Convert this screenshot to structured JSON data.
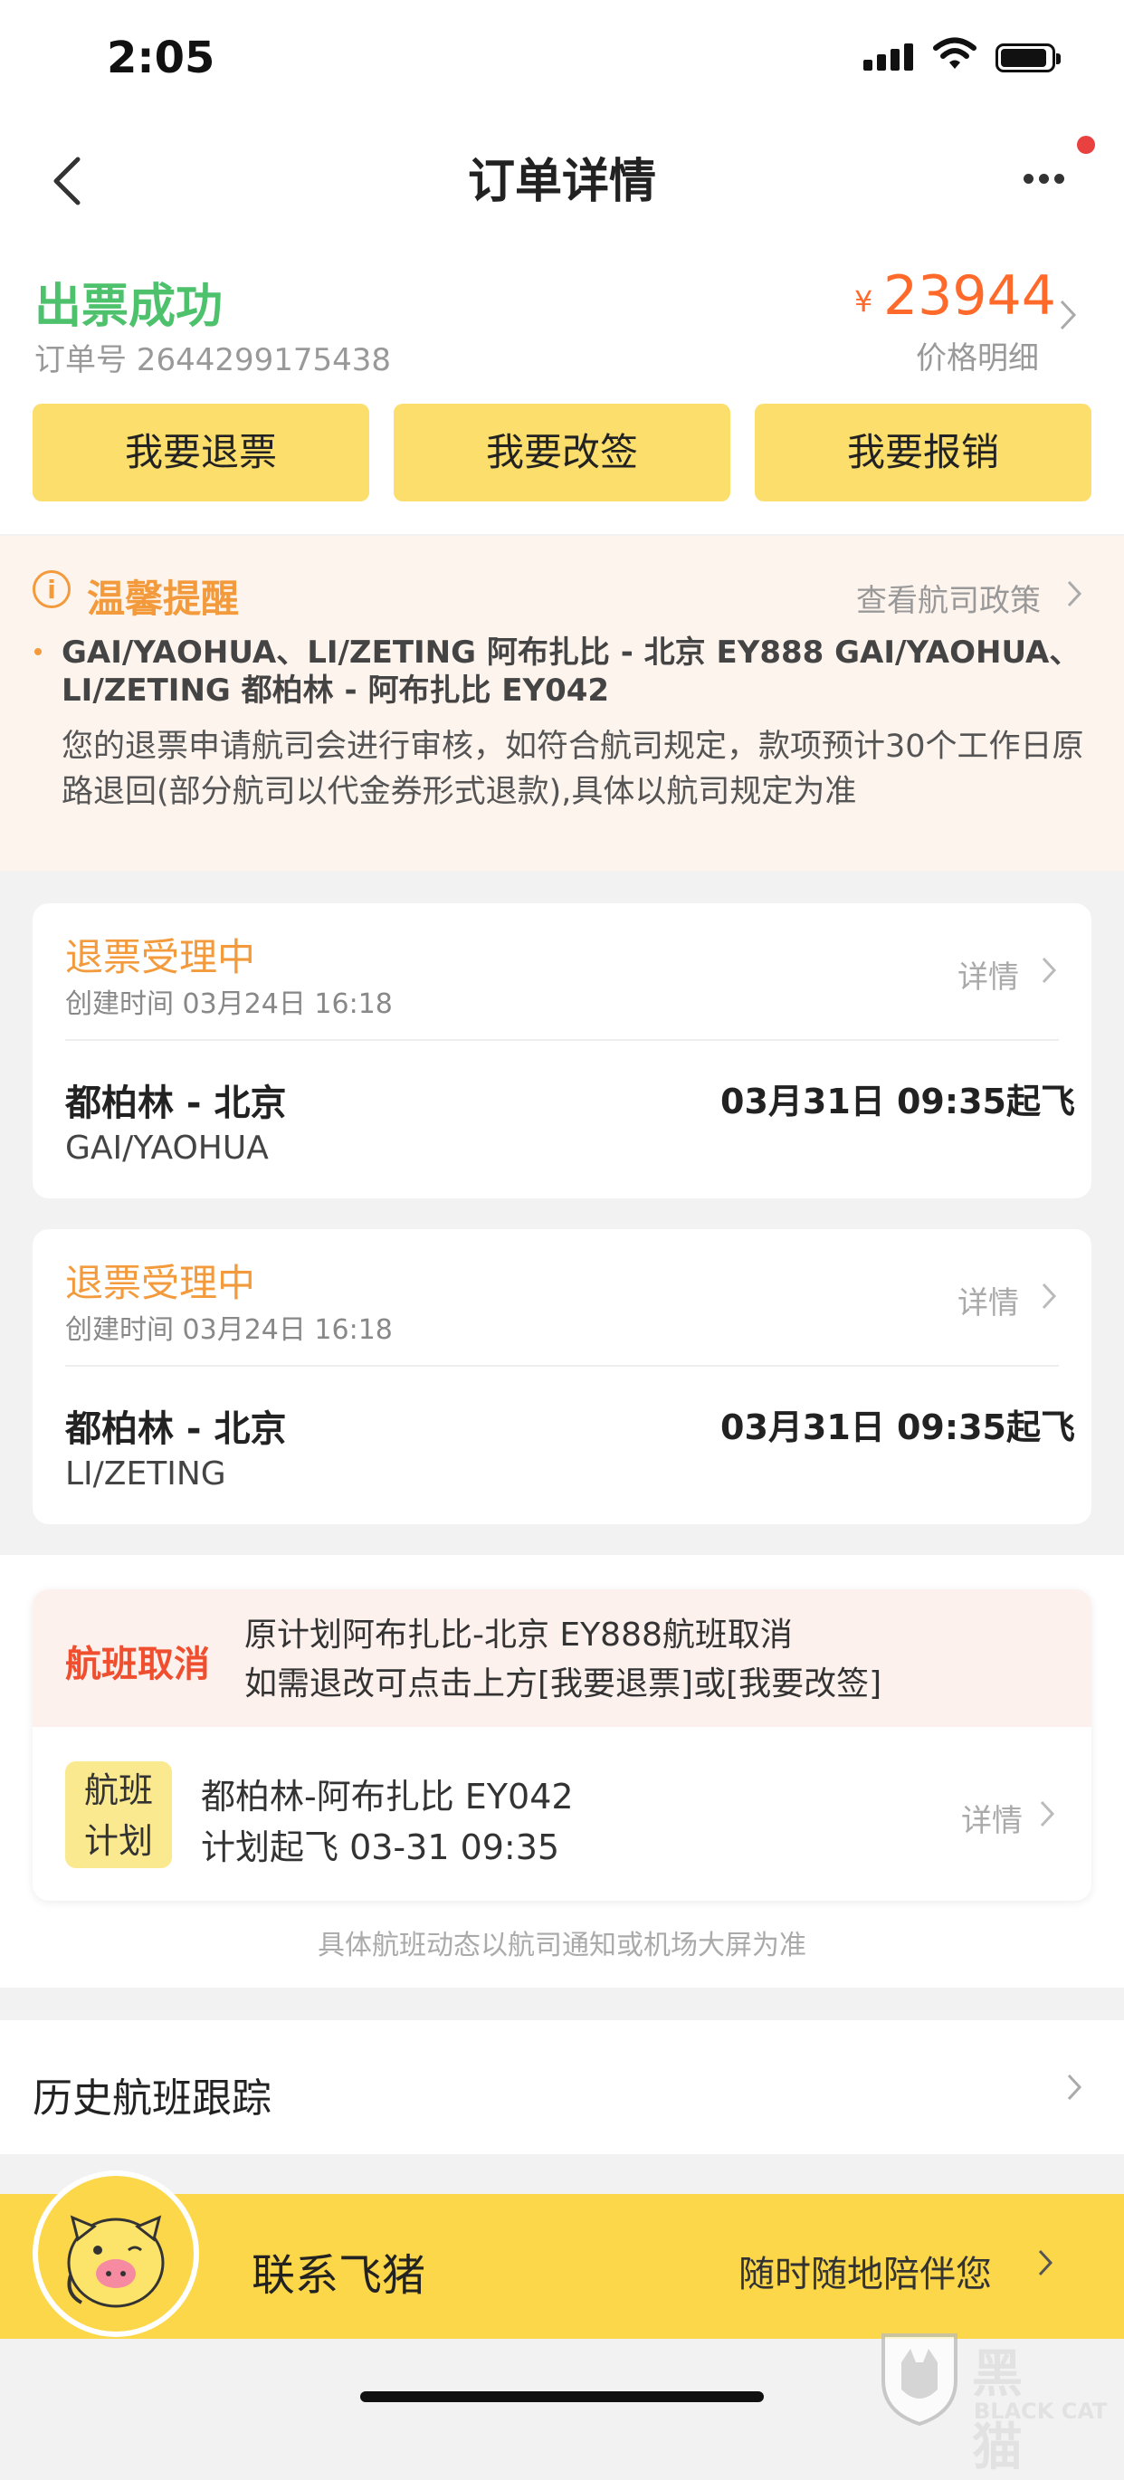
{
  "status_bar": {
    "time": "2:05"
  },
  "nav": {
    "title": "订单详情"
  },
  "order": {
    "status": "出票成功",
    "order_no": "订单号 2644299175438",
    "currency": "¥",
    "price": "23944",
    "price_detail": "价格明细",
    "buttons": [
      "我要退票",
      "我要改签",
      "我要报销"
    ]
  },
  "reminder": {
    "title": "温馨提醒",
    "policy_link": "查看航司政策",
    "flights": "GAI/YAOHUA、LI/ZETING 阿布扎比 - 北京 EY888 GAI/YAOHUA、LI/ZETING 都柏林 - 阿布扎比 EY042",
    "text": "您的退票申请航司会进行审核，如符合航司规定，款项预计30个工作日原路退回(部分航司以代金券形式退款),具体以航司规定为准"
  },
  "refunds": [
    {
      "status": "退票受理中",
      "created": "创建时间 03月24日 16:18",
      "detail": "详情",
      "route": "都柏林 - 北京",
      "passenger": "GAI/YAOHUA",
      "departure": "03月31日 09:35起飞"
    },
    {
      "status": "退票受理中",
      "created": "创建时间 03月24日 16:18",
      "detail": "详情",
      "route": "都柏林 - 北京",
      "passenger": "LI/ZETING",
      "departure": "03月31日 09:35起飞"
    }
  ],
  "cancel": {
    "tag": "航班取消",
    "line1": "原计划阿布扎比-北京 EY888航班取消",
    "line2": "如需退改可点击上方[我要退票]或[我要改签]",
    "plan_tag_1": "航班",
    "plan_tag_2": "计划",
    "plan_route": "都柏林-阿布扎比 EY042",
    "plan_time": "计划起飞 03-31 09:35",
    "detail": "详情"
  },
  "note": "具体航班动态以航司通知或机场大屏为准",
  "history": {
    "label": "历史航班跟踪"
  },
  "contact": {
    "label": "联系飞猪",
    "sub": "随时随地陪伴您"
  },
  "watermark": {
    "cn": "黑猫",
    "en": "BLACK CAT"
  },
  "colors": {
    "success": "#4ec16c",
    "price": "#ff6a2b",
    "accent_yellow": "#fbde6b",
    "warning": "#f39b3c",
    "cancel_red": "#f04f2f"
  }
}
